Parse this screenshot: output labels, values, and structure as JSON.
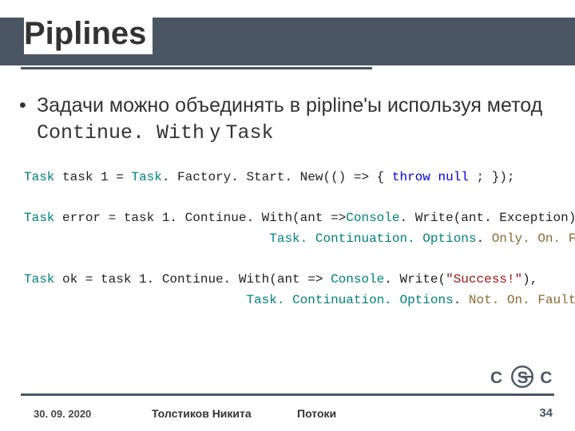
{
  "title": "Piplines",
  "bullet": {
    "prefix": "Задачи можно объединять в pipline'ы используя метод ",
    "method": "Continue. With",
    "mid": " у ",
    "class": "Task"
  },
  "code": {
    "l1a": " task 1 = ",
    "l1b": ". Factory. Start. New(() => { ",
    "l1c": " ; });",
    "kw_throw": "throw",
    "kw_null": "null",
    "typ_task": "Task",
    "l3a": " error = task 1. Continue. With(ant =>",
    "l3b": ". Write(ant. Exception),",
    "typ_console": "Console",
    "l4_indent": "                                ",
    "l4a": ". ",
    "opt_only": "Only. On. Faulted",
    "typ_tco": "Task. Continuation. Options",
    "l4b": ");",
    "l6a": " ok = task 1. Continue. With(ant => ",
    "l6b": ". Write(",
    "str_success": "\"Success!\"",
    "l6c": "),",
    "l7_indent": "                             ",
    "opt_not": "Not. On. Faulted",
    "l7b": ");"
  },
  "footer": {
    "date": "30. 09. 2020",
    "author": "Толстиков Никита",
    "section": "Потоки",
    "page": "34"
  },
  "logo_text": "CSC"
}
